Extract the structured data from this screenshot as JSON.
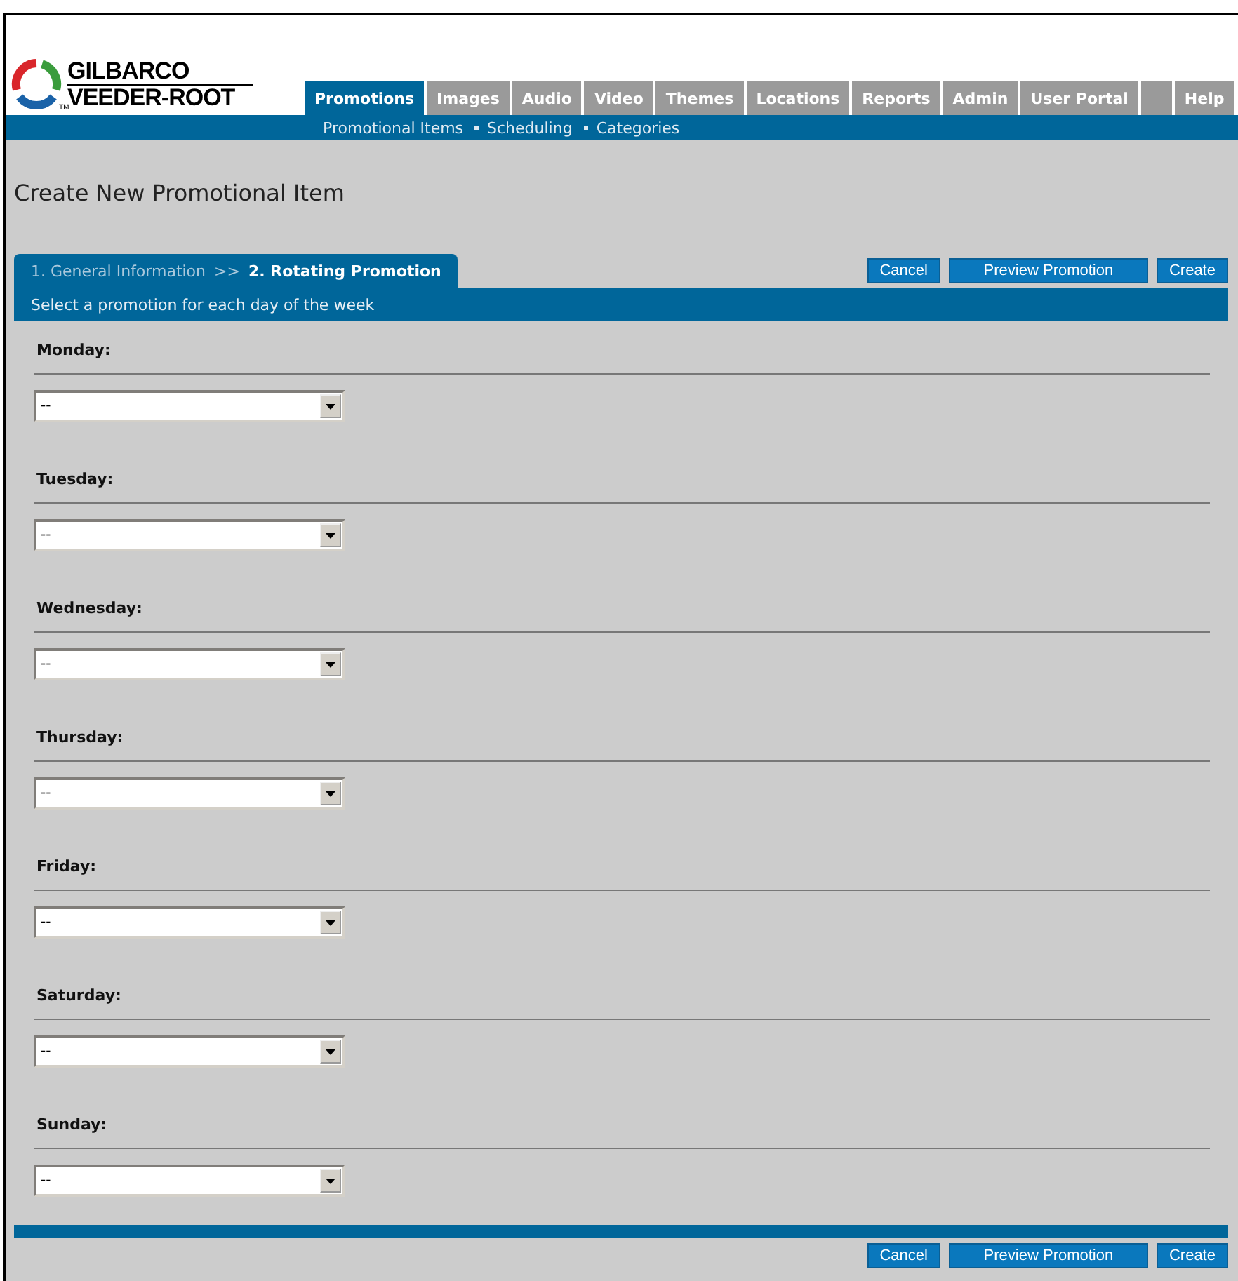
{
  "logo": {
    "line_1": "GILBARCO",
    "line_2": "VEEDER-ROOT",
    "mark": "TM"
  },
  "tabs": [
    {
      "label": "Promotions",
      "selected": true
    },
    {
      "label": "Images",
      "selected": false
    },
    {
      "label": "Audio",
      "selected": false
    },
    {
      "label": "Video",
      "selected": false
    },
    {
      "label": "Themes",
      "selected": false
    },
    {
      "label": "Locations",
      "selected": false
    },
    {
      "label": "Reports",
      "selected": false
    },
    {
      "label": "Admin",
      "selected": false
    },
    {
      "label": "User Portal",
      "selected": false
    },
    {
      "selected": false
    },
    {
      "label": "Help",
      "selected": false
    }
  ],
  "subnav": [
    "Promotional Items",
    "Scheduling",
    "Categories"
  ],
  "page_title": "Create New Promotional Item",
  "steps": [
    {
      "label": "1. General Information",
      "selected": false
    },
    {
      "label": "2. Rotating Promotion",
      "selected": true
    }
  ],
  "step_separator": ">>",
  "buttons": [
    "Cancel",
    "Preview Promotion",
    "Create"
  ],
  "instruction": "Select a promotion for each day of the week",
  "days": [
    {
      "label": "Monday:",
      "value": "--"
    },
    {
      "label": "Tuesday:",
      "value": "--"
    },
    {
      "label": "Wednesday:",
      "value": "--"
    },
    {
      "label": "Thursday:",
      "value": "--"
    },
    {
      "label": "Friday:",
      "value": "--"
    },
    {
      "label": "Saturday:",
      "value": "--"
    },
    {
      "label": "Sunday:",
      "value": "--"
    }
  ],
  "bottom_buttons": [
    "Cancel",
    "Preview Promotion",
    "Create"
  ]
}
